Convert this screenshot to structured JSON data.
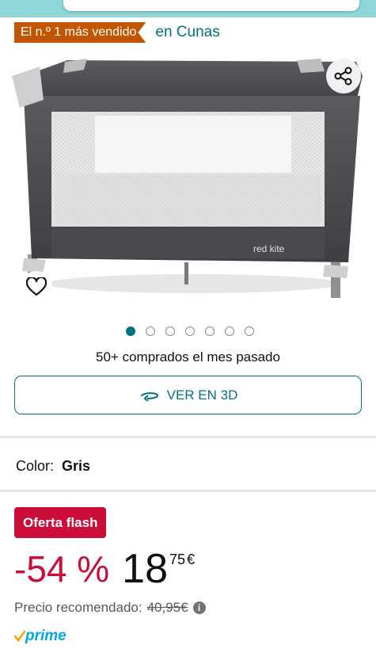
{
  "badge": {
    "label": "El n.º 1 más vendido",
    "category": "en Cunas"
  },
  "product": {
    "image_alt": "Cuna de viaje gris",
    "brand_print": "red kite"
  },
  "gallery": {
    "dots": 7,
    "active_dot": 0
  },
  "bought": "50+ comprados el mes pasado",
  "view3d": {
    "label": "VER EN 3D"
  },
  "color": {
    "label": "Color:",
    "value": "Gris"
  },
  "deal": {
    "badge": "Oferta flash",
    "discount": "-54 %",
    "price_whole": "18",
    "price_fraction": "75",
    "currency": "€",
    "rrp_label": "Precio recomendado:",
    "rrp_value": "40,95€"
  },
  "prime": {
    "label": "prime"
  },
  "icons": {
    "share": "share-icon",
    "wishlist": "heart-icon",
    "rotate": "rotate-3d-icon",
    "info": "info-icon",
    "prime_check": "check-icon"
  },
  "colors": {
    "accent": "#007185",
    "deal_red": "#cc0c39",
    "badge_orange": "#c45500",
    "prime_blue": "#00a8e1"
  }
}
